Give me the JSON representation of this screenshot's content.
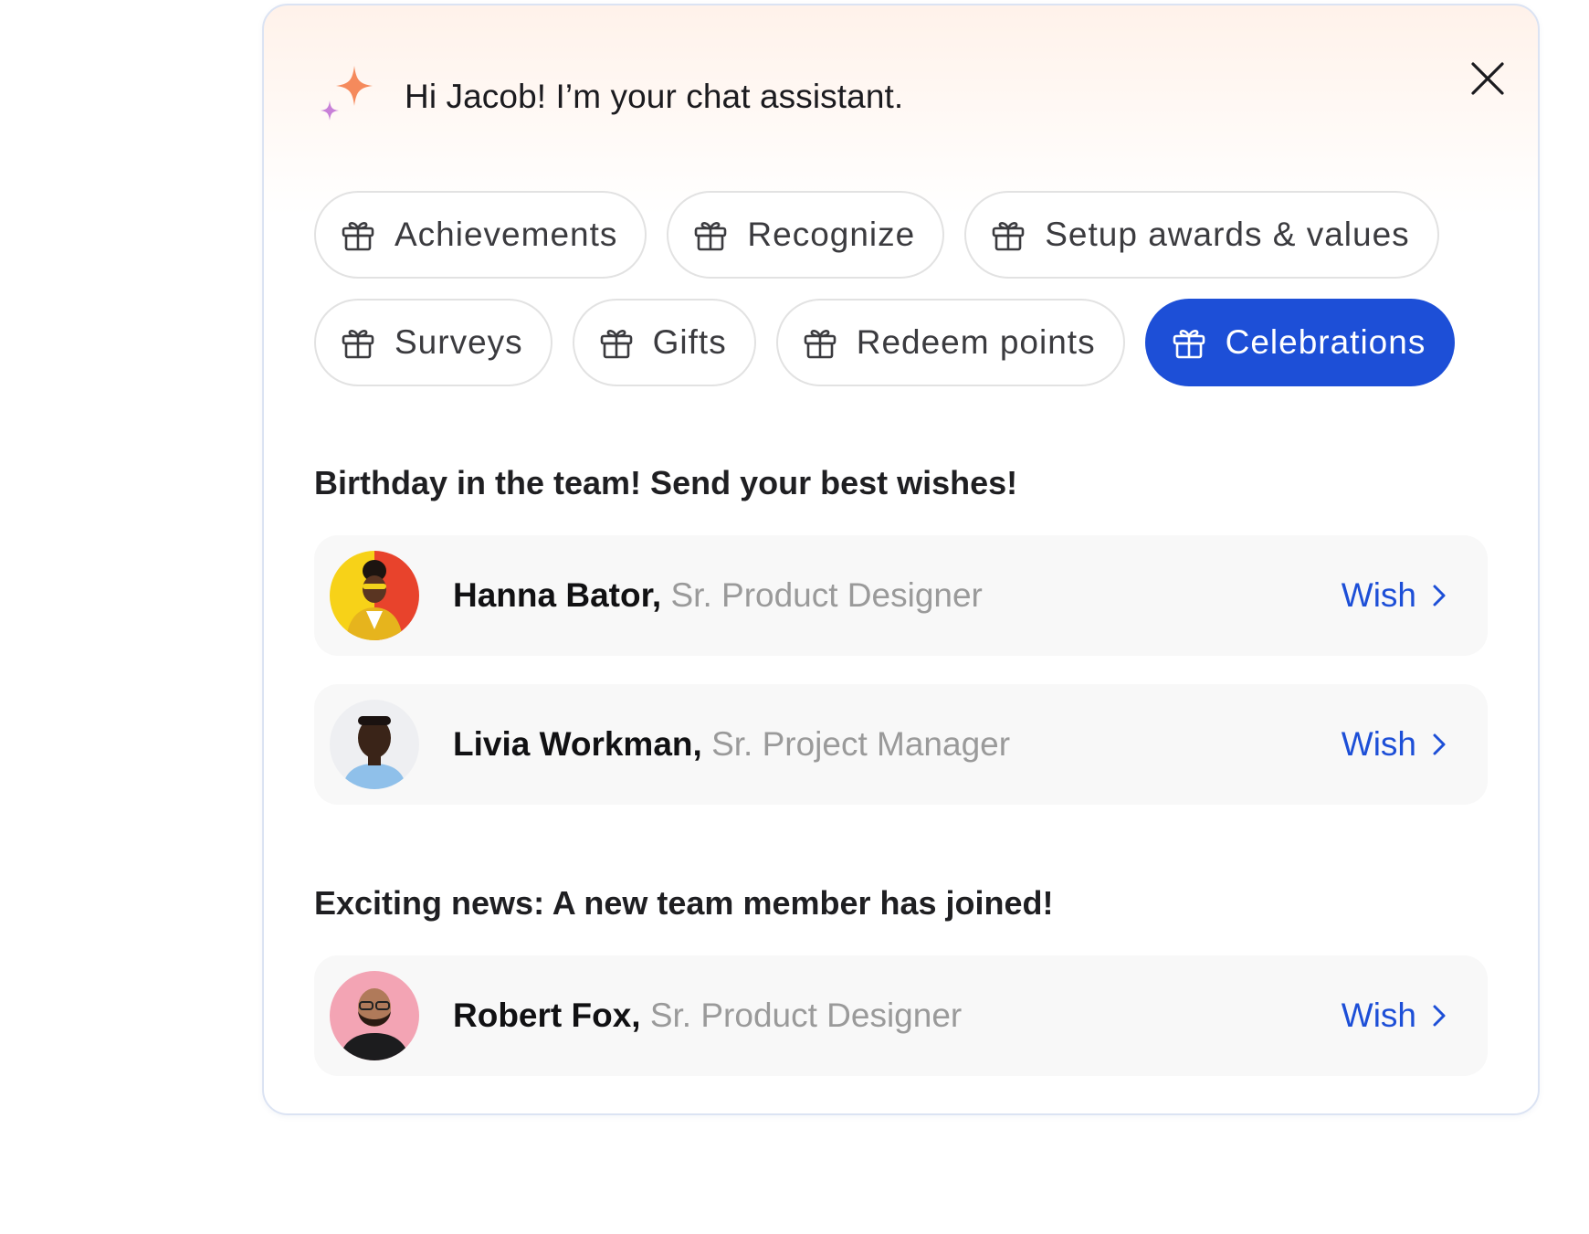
{
  "assistant": {
    "greeting": "Hi Jacob! I’m your chat assistant.",
    "sparkle_colors": [
      "#f58a5c",
      "#c880d8"
    ]
  },
  "chips": [
    {
      "label": "Achievements",
      "icon": "gift-icon",
      "active": false
    },
    {
      "label": "Recognize",
      "icon": "gift-icon",
      "active": false
    },
    {
      "label": "Setup awards & values",
      "icon": "gift-icon",
      "active": false
    },
    {
      "label": "Surveys",
      "icon": "gift-icon",
      "active": false
    },
    {
      "label": "Gifts",
      "icon": "gift-icon",
      "active": false
    },
    {
      "label": "Redeem points",
      "icon": "gift-icon",
      "active": false
    },
    {
      "label": "Celebrations",
      "icon": "gift-icon",
      "active": true
    }
  ],
  "birthday": {
    "title": "Birthday in the team! Send your best wishes!",
    "people": [
      {
        "name": "Hanna Bator,",
        "role": "Sr. Product Designer",
        "action": "Wish"
      },
      {
        "name": "Livia Workman,",
        "role": "Sr. Project Manager",
        "action": "Wish"
      }
    ]
  },
  "new_member": {
    "title": "Exciting news: A new team member has joined!",
    "people": [
      {
        "name": "Robert Fox,",
        "role": "Sr. Product Designer",
        "action": "Wish"
      }
    ]
  },
  "colors": {
    "accent": "#1d4fd7",
    "muted_text": "#9a9a9a",
    "card_bg": "#f8f8f8"
  }
}
